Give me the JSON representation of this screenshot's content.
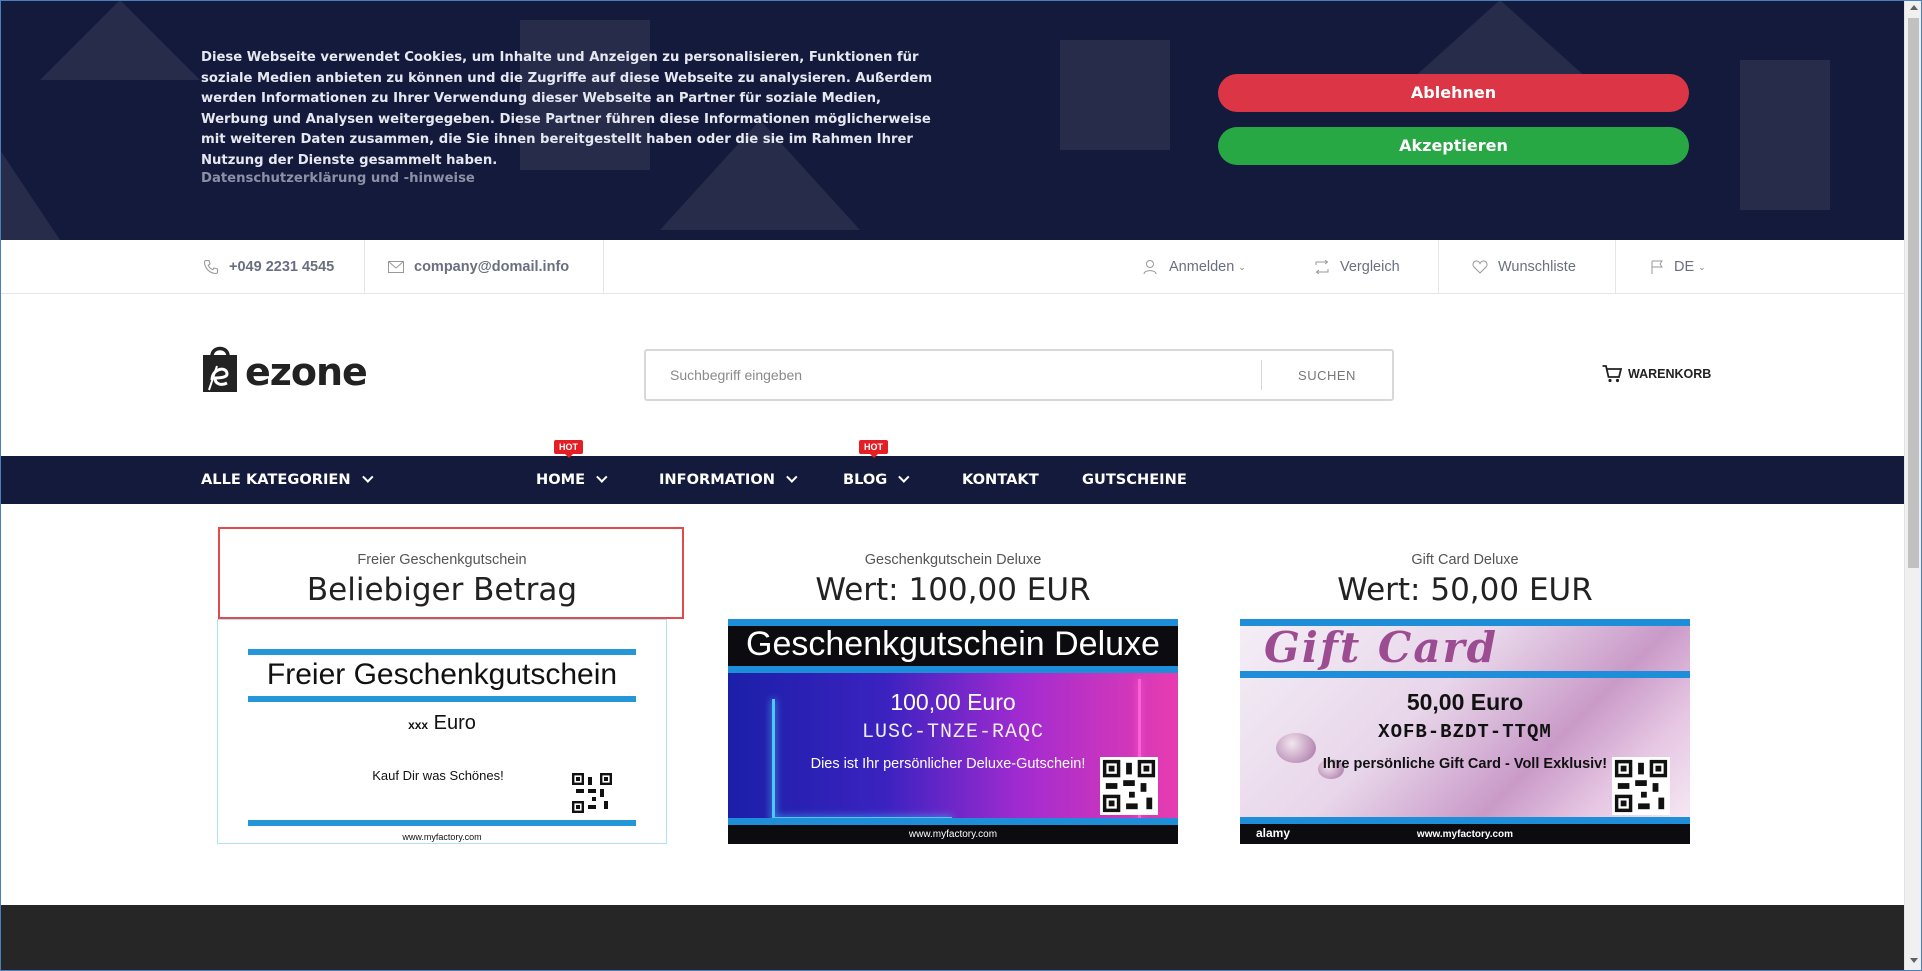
{
  "cookie": {
    "text": "Diese Webseite verwendet Cookies, um Inhalte und Anzeigen zu personalisieren, Funktionen für soziale Medien anbieten zu können und die Zugriffe auf diese Webseite zu analysieren. Außerdem werden Informationen zu Ihrer Verwendung dieser Webseite an Partner für soziale Medien, Werbung und Analysen weitergegeben. Diese Partner führen diese Informationen möglicherweise mit weiteren Daten zusammen, die Sie ihnen bereitgestellt haben oder die sie im Rahmen Ihrer Nutzung der Dienste gesammelt haben.",
    "privacy_link": "Datenschutzerklärung und -hinweise",
    "reject_label": "Ablehnen",
    "accept_label": "Akzeptieren",
    "reject_color": "#dc3545",
    "accept_color": "#28a745"
  },
  "topbar": {
    "phone": "+049 2231 4545",
    "email": "company@domail.info",
    "login": "Anmelden",
    "compare": "Vergleich",
    "wishlist": "Wunschliste",
    "language": "DE"
  },
  "header": {
    "logo_text": "ezone",
    "search_placeholder": "Suchbegriff eingeben",
    "search_button": "SUCHEN",
    "cart_label": "WARENKORB"
  },
  "nav": {
    "items": [
      {
        "label": "ALLE KATEGORIEN"
      },
      {
        "label": "HOME",
        "badge": "HOT"
      },
      {
        "label": "INFORMATION"
      },
      {
        "label": "BLOG",
        "badge": "HOT"
      },
      {
        "label": "KONTAKT"
      },
      {
        "label": "GUTSCHEINE"
      }
    ],
    "background": "#141a3c"
  },
  "products": [
    {
      "subtitle": "Freier Geschenkgutschein",
      "title": "Beliebiger Betrag",
      "card": {
        "heading": "Freier Geschenkgutschein",
        "value_prefix": "xxx",
        "value_suffix": "Euro",
        "message": "Kauf Dir was Schönes!",
        "url": "www.myfactory.com"
      }
    },
    {
      "subtitle": "Geschenkgutschein Deluxe",
      "title": "Wert: 100,00 EUR",
      "card": {
        "heading": "Geschenkgutschein Deluxe",
        "value": "100,00 Euro",
        "code": "LUSC-TNZE-RAQC",
        "message": "Dies ist Ihr persönlicher Deluxe-Gutschein!",
        "url": "www.myfactory.com"
      }
    },
    {
      "subtitle": "Gift Card Deluxe",
      "title": "Wert: 50,00 EUR",
      "card": {
        "heading": "Gift Card",
        "value": "50,00 Euro",
        "code": "XOFB-BZDT-TTQM",
        "message": "Ihre persönliche Gift Card - Voll Exklusiv!",
        "watermark": "alamy",
        "url": "www.myfactory.com"
      }
    }
  ],
  "icons": [
    "phone-icon",
    "mail-icon",
    "user-icon",
    "compare-icon",
    "heart-icon",
    "flag-icon",
    "cart-icon",
    "chevron-down-icon",
    "qr-code-icon"
  ]
}
